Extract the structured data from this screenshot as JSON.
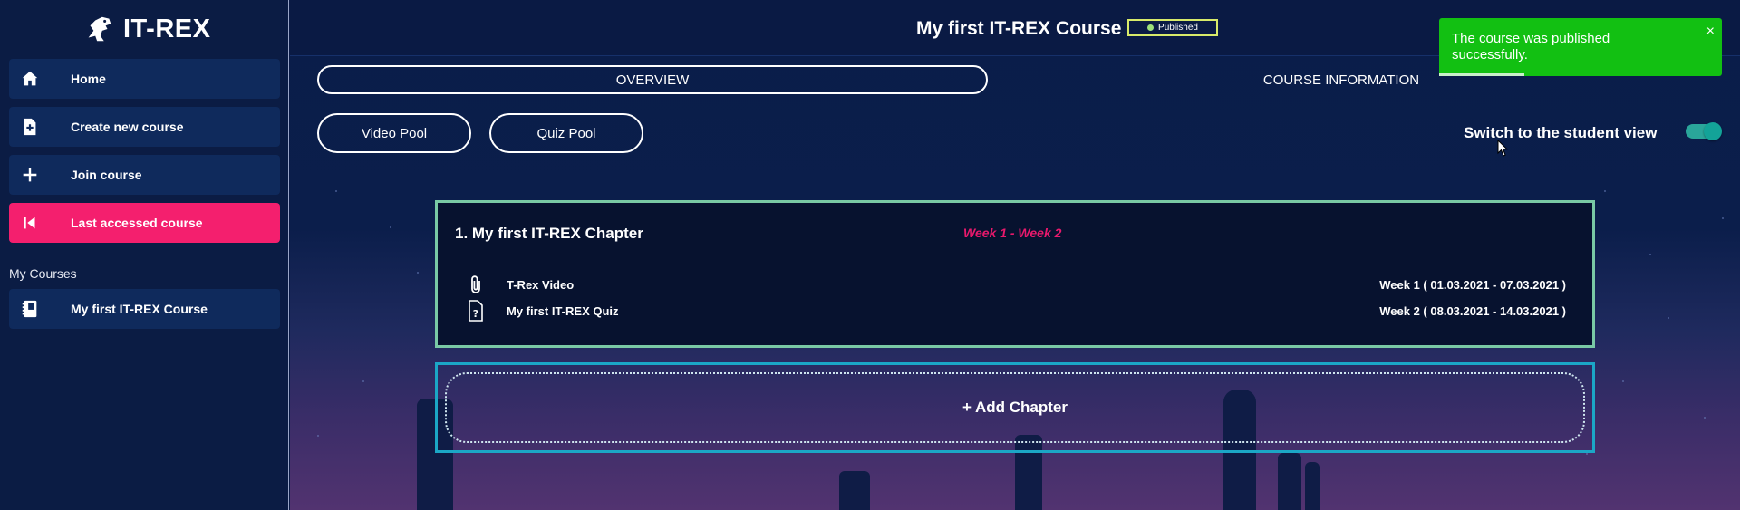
{
  "app": {
    "logo_text": "IT-REX"
  },
  "sidebar": {
    "items": [
      {
        "label": "Home",
        "icon": "home-icon",
        "active": false
      },
      {
        "label": "Create new course",
        "icon": "file-plus-icon",
        "active": false
      },
      {
        "label": "Join course",
        "icon": "plus-icon",
        "active": false
      },
      {
        "label": "Last accessed course",
        "icon": "skip-back-icon",
        "active": true
      }
    ],
    "my_courses_title": "My Courses",
    "courses": [
      {
        "label": "My first IT-REX Course",
        "icon": "notebook-icon"
      }
    ]
  },
  "header": {
    "course_title": "My first IT-REX Course",
    "status_badge": "Published"
  },
  "tabs": {
    "overview": "OVERVIEW",
    "course_information": "COURSE INFORMATION"
  },
  "pools": {
    "video_pool": "Video Pool",
    "quiz_pool": "Quiz Pool"
  },
  "student_view": {
    "label": "Switch to the student view",
    "enabled": true
  },
  "chapter": {
    "title": "1. My first IT-REX Chapter",
    "weeks": "Week 1 - Week 2",
    "items": [
      {
        "name": "T-Rex Video",
        "dates": "Week 1 ( 01.03.2021 - 07.03.2021 )",
        "icon": "paperclip-icon"
      },
      {
        "name": "My first IT-REX Quiz",
        "dates": "Week 2 ( 08.03.2021 - 14.03.2021 )",
        "icon": "quiz-file-icon"
      }
    ]
  },
  "add_chapter": {
    "label": "+ Add Chapter"
  },
  "toast": {
    "message": "The course was published successfully.",
    "close": "×",
    "progress": 0.3
  },
  "colors": {
    "sidebar_bg": "#0b1c44",
    "nav_item_bg": "#0f2a5c",
    "active_pink": "#f41f6e",
    "chapter_border": "#79c9a5",
    "add_chapter_border": "#1ba7c6",
    "weeks_pink": "#e8196c",
    "toast_green": "#12c012",
    "toggle_teal": "#2aa69a"
  }
}
